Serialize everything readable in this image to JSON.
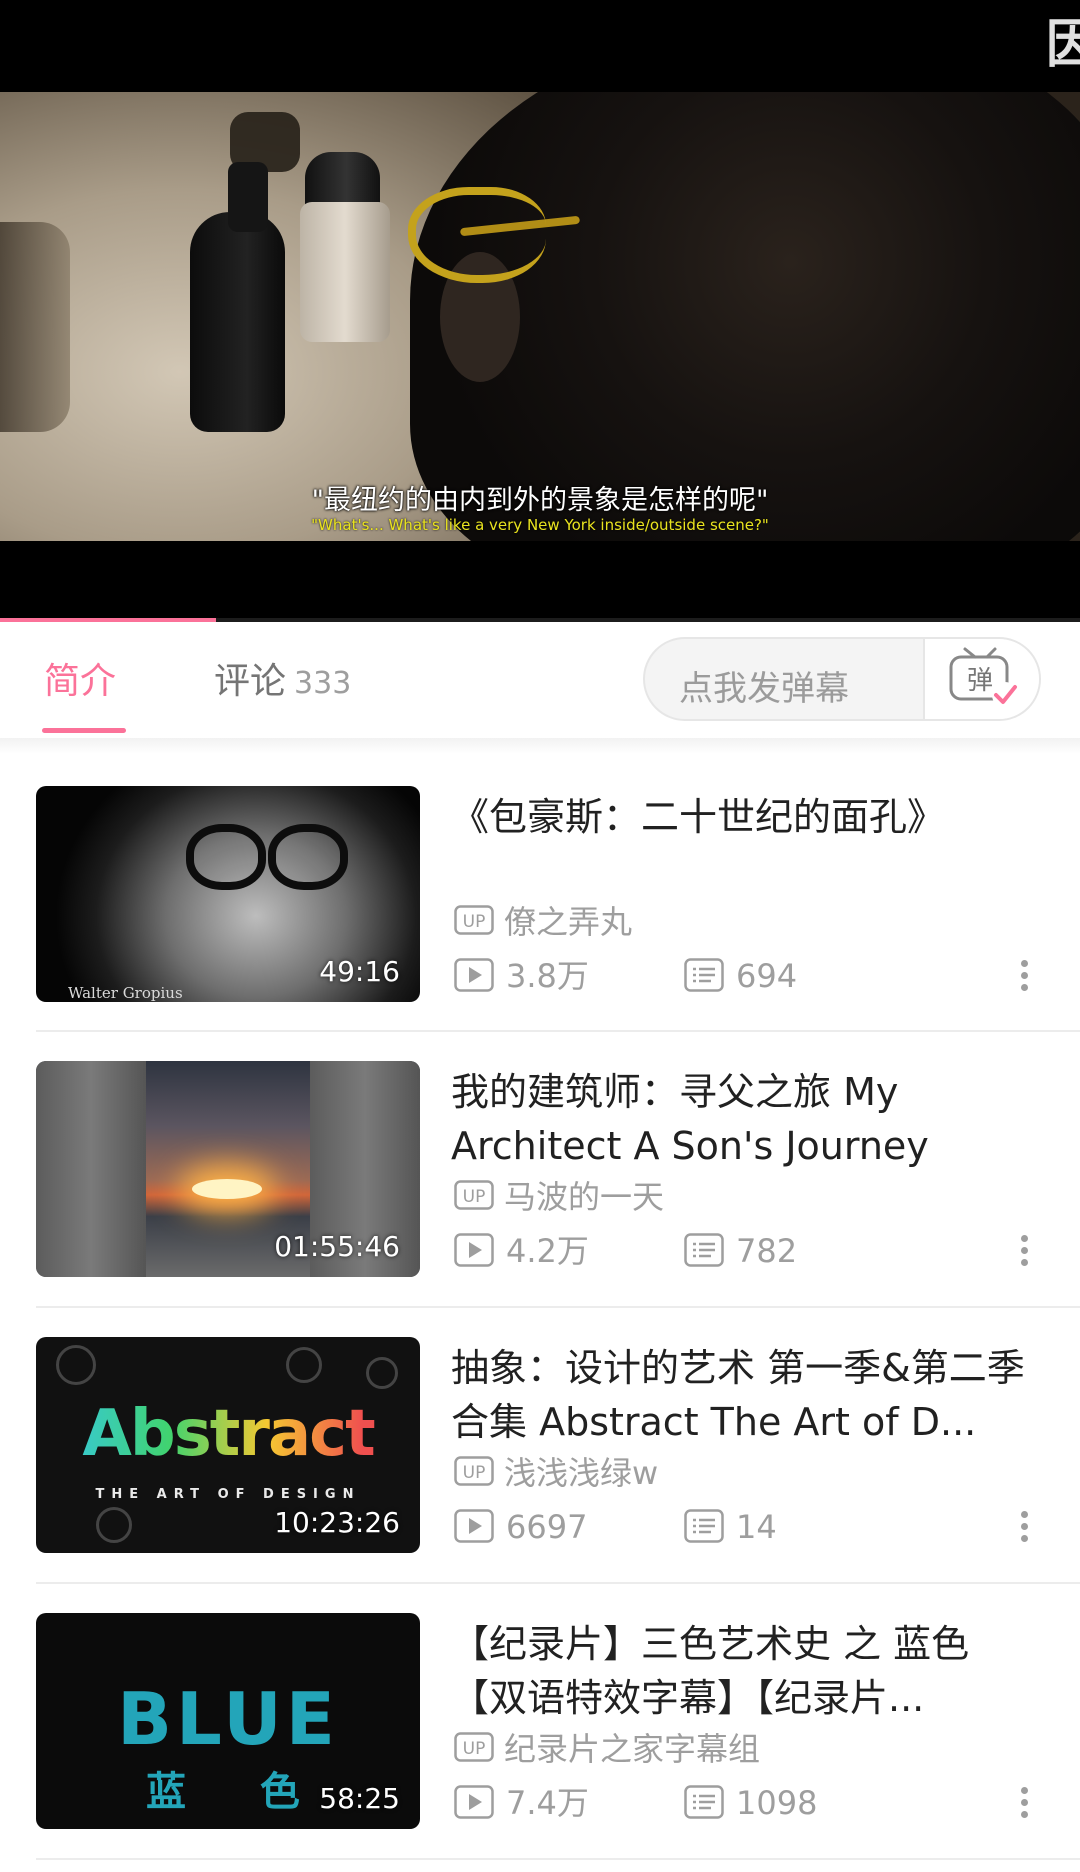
{
  "player": {
    "top_char": "因",
    "subtitle_cn": "\"最纽约的由内到外的景象是怎样的呢\"",
    "subtitle_en": "\"What's... What's like a very New York inside/outside scene?\"",
    "progress": 0.2
  },
  "tabs": {
    "intro_label": "简介",
    "comments_label": "评论",
    "comments_count": "333",
    "danmaku_placeholder": "点我发弹幕",
    "danmaku_button_char": "弹"
  },
  "up_badge": "UP",
  "videos": [
    {
      "title": "《包豪斯：二十世纪的面孔》",
      "duration": "49:16",
      "uploader": "僚之弄丸",
      "views": "3.8万",
      "danmaku": "694",
      "thumb_caption": "Walter Gropius"
    },
    {
      "title": "我的建筑师：寻父之旅 My Architect A Son's Journey",
      "duration": "01:55:46",
      "uploader": "马波的一天",
      "views": "4.2万",
      "danmaku": "782"
    },
    {
      "title": "抽象：设计的艺术 第一季&第二季合集 Abstract The Art of D...",
      "duration": "10:23:26",
      "uploader": "浅浅浅绿w",
      "views": "6697",
      "danmaku": "14",
      "thumb_title": "Abstract",
      "thumb_subtitle": "THE ART OF DESIGN"
    },
    {
      "title": "【纪录片】三色艺术史 之 蓝色【双语特效字幕】【纪录片...",
      "duration": "58:25",
      "uploader": "纪录片之家字幕组",
      "views": "7.4万",
      "danmaku": "1098",
      "thumb_title": "BLUE",
      "thumb_subtitle": "蓝 色"
    }
  ],
  "icons": {
    "up": "up-badge-icon",
    "views": "play-icon",
    "danmaku": "danmaku-icon",
    "more": "more-vert-icon"
  },
  "colors": {
    "accent": "#fb7299",
    "text_primary": "#212121",
    "text_secondary": "#9e9e9e"
  }
}
